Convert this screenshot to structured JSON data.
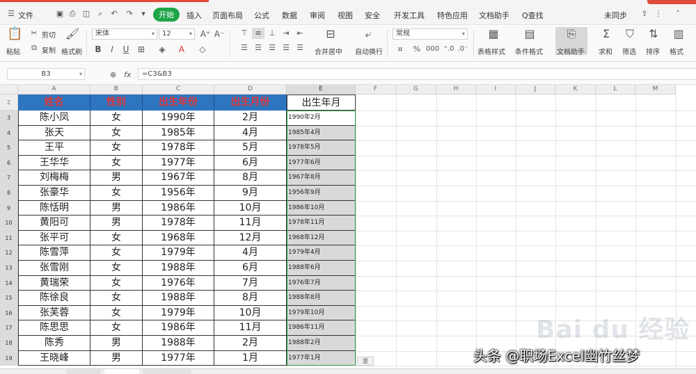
{
  "tabbar": {
    "file_label": "文件",
    "items": [
      "开始",
      "插入",
      "页面布局",
      "公式",
      "数据",
      "审阅",
      "视图",
      "安全",
      "开发工具",
      "特色应用",
      "文档助手"
    ],
    "active_index": 0,
    "search_label": "Q查找",
    "right_label": "未同步"
  },
  "ribbon": {
    "paste": "粘贴",
    "cut": "剪切",
    "copy": "复制",
    "format_painter": "格式刷",
    "font_name": "宋体",
    "font_size": "12",
    "merge_center": "合并居中",
    "wrap_text": "自动换行",
    "number_format": "常规",
    "table_style": "表格样式",
    "conditional_format": "条件格式",
    "text_tool": "文档助手",
    "sum": "求和",
    "filter": "筛选",
    "sort": "排序",
    "format": "格式"
  },
  "formula_bar": {
    "cell_ref": "B3",
    "formula": "=C3&B3"
  },
  "columns": [
    "A",
    "B",
    "C",
    "D",
    "E",
    "F",
    "G",
    "H",
    "I",
    "J",
    "K",
    "L",
    "M"
  ],
  "headers": [
    "姓名",
    "性别",
    "出生年份",
    "出生月份",
    "出生年月"
  ],
  "row_numbers": [
    "2",
    "3",
    "4",
    "5",
    "6",
    "7",
    "8",
    "9",
    "10",
    "11",
    "12",
    "13",
    "14",
    "15",
    "16",
    "17",
    "18",
    "19"
  ],
  "rows": [
    {
      "name": "陈小凤",
      "gender": "女",
      "year": "1990年",
      "month": "2月",
      "combined": "1990年2月"
    },
    {
      "name": "张天",
      "gender": "女",
      "year": "1985年",
      "month": "4月",
      "combined": "1985年4月"
    },
    {
      "name": "王平",
      "gender": "女",
      "year": "1978年",
      "month": "5月",
      "combined": "1978年5月"
    },
    {
      "name": "王华华",
      "gender": "女",
      "year": "1977年",
      "month": "6月",
      "combined": "1977年6月"
    },
    {
      "name": "刘梅梅",
      "gender": "男",
      "year": "1967年",
      "month": "8月",
      "combined": "1967年8月"
    },
    {
      "name": "张豪华",
      "gender": "女",
      "year": "1956年",
      "month": "9月",
      "combined": "1956年9月"
    },
    {
      "name": "陈恬明",
      "gender": "男",
      "year": "1986年",
      "month": "10月",
      "combined": "1986年10月"
    },
    {
      "name": "黄阳可",
      "gender": "男",
      "year": "1978年",
      "month": "11月",
      "combined": "1978年11月"
    },
    {
      "name": "张平可",
      "gender": "女",
      "year": "1968年",
      "month": "12月",
      "combined": "1968年12月"
    },
    {
      "name": "陈雪萍",
      "gender": "女",
      "year": "1979年",
      "month": "4月",
      "combined": "1979年4月"
    },
    {
      "name": "张雪刚",
      "gender": "女",
      "year": "1988年",
      "month": "6月",
      "combined": "1988年6月"
    },
    {
      "name": "黄瑞荣",
      "gender": "女",
      "year": "1976年",
      "month": "7月",
      "combined": "1976年7月"
    },
    {
      "name": "陈徐良",
      "gender": "女",
      "year": "1988年",
      "month": "8月",
      "combined": "1988年8月"
    },
    {
      "name": "张芙蓉",
      "gender": "女",
      "year": "1979年",
      "month": "10月",
      "combined": "1979年10月"
    },
    {
      "name": "陈思思",
      "gender": "女",
      "year": "1986年",
      "month": "11月",
      "combined": "1986年11月"
    },
    {
      "name": "陈秀",
      "gender": "男",
      "year": "1988年",
      "month": "2月",
      "combined": "1988年2月"
    },
    {
      "name": "王晓峰",
      "gender": "男",
      "year": "1977年",
      "month": "1月",
      "combined": "1977年1月"
    }
  ],
  "watermarks": {
    "baidu": "Bai du 经验",
    "toutiao": "头条 @职场Excel幽竹丝梦"
  },
  "fill_handle_label": "毘"
}
